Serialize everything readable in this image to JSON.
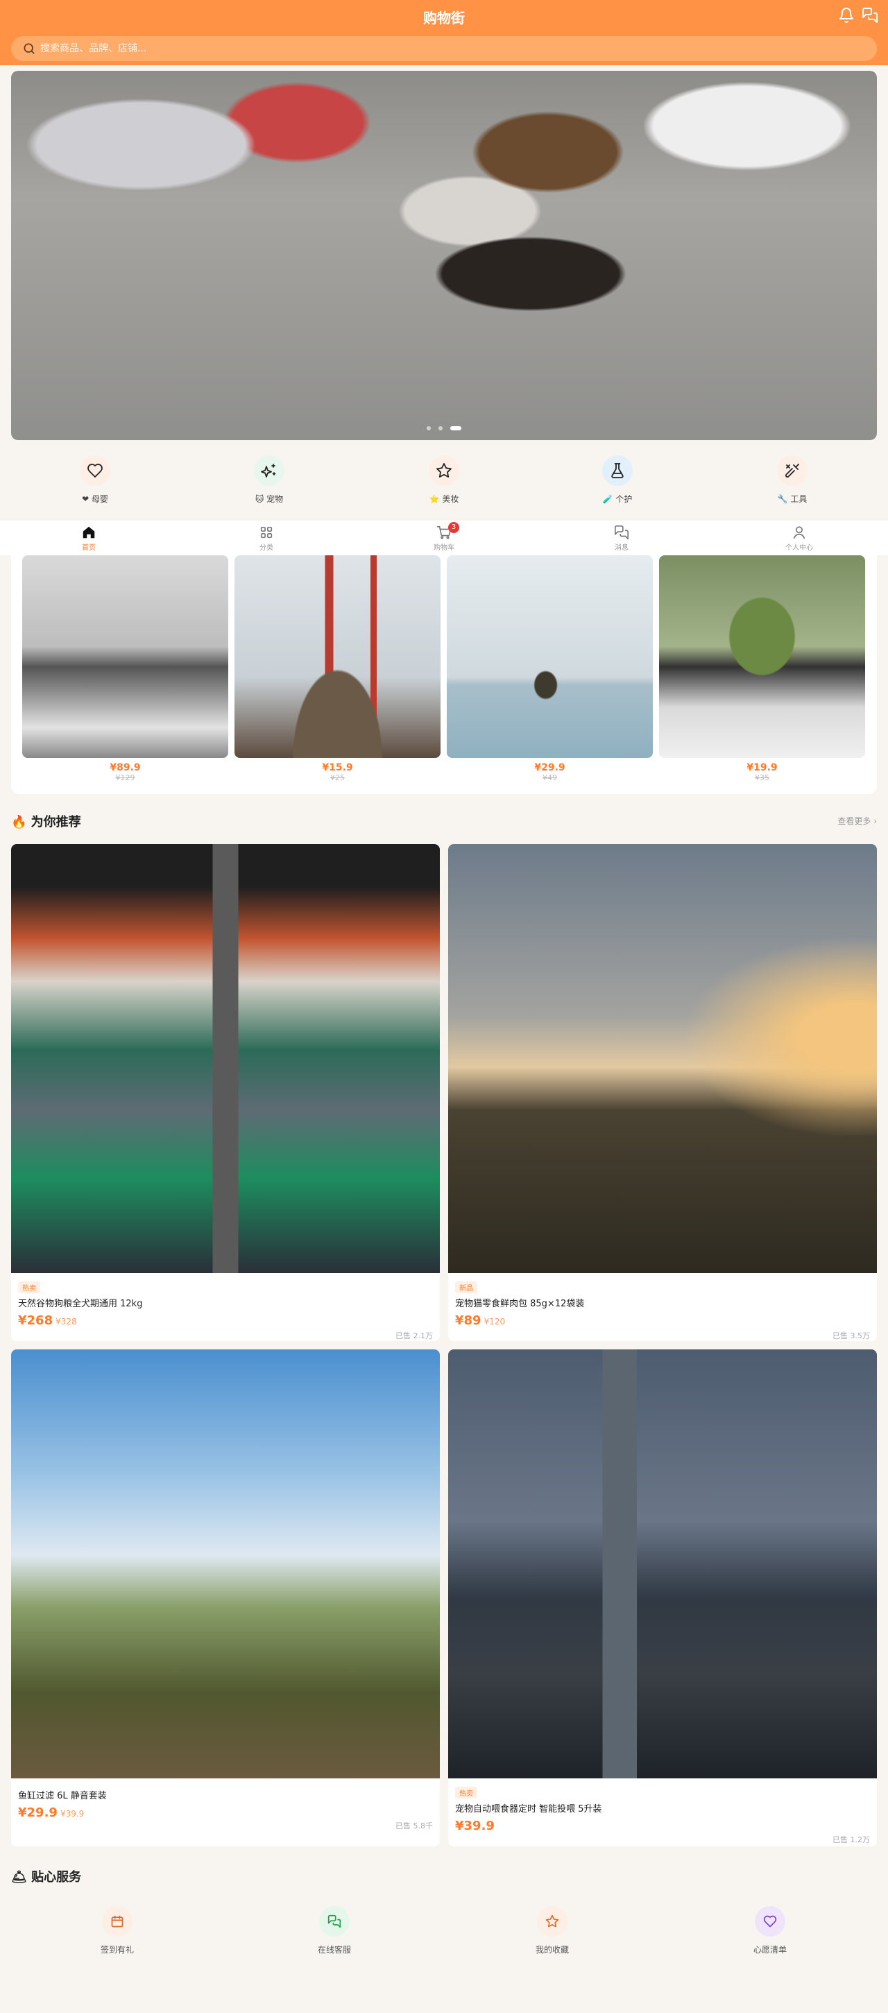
{
  "app": {
    "title": "购物街"
  },
  "search": {
    "placeholder": "搜索商品、品牌、店铺..."
  },
  "banner": {
    "slides": 3,
    "active_slide": 3
  },
  "categories": [
    {
      "label": "❤ 母婴",
      "icon": "heart-icon",
      "bg": "#fdeee6",
      "color": "#222"
    },
    {
      "label": "🐱 宠物",
      "icon": "sparkles-icon",
      "bg": "#e8f7ee",
      "color": "#222"
    },
    {
      "label": "⭐ 美妆",
      "icon": "star-icon",
      "bg": "#fdeee6",
      "color": "#222"
    },
    {
      "label": "🧪 个护",
      "icon": "flask-icon",
      "bg": "#e1f0fb",
      "color": "#222"
    },
    {
      "label": "🔧 工具",
      "icon": "tools-icon",
      "bg": "#fdeee6",
      "color": "#222"
    }
  ],
  "tabbar": {
    "items": [
      {
        "label": "首页",
        "icon": "home-icon",
        "active": true
      },
      {
        "label": "分类",
        "icon": "grid-icon",
        "active": false
      },
      {
        "label": "购物车",
        "icon": "cart-icon",
        "active": false,
        "badge": "3"
      },
      {
        "label": "消息",
        "icon": "chat-icon",
        "active": false
      },
      {
        "label": "个人中心",
        "icon": "user-icon",
        "active": false
      }
    ]
  },
  "flash_sale": {
    "items": [
      {
        "price": "¥89.9",
        "original": "¥129"
      },
      {
        "price": "¥15.9",
        "original": "¥25"
      },
      {
        "price": "¥29.9",
        "original": "¥49"
      },
      {
        "price": "¥19.9",
        "original": "¥35"
      }
    ]
  },
  "recommend": {
    "title": "🔥 为你推荐",
    "more": "查看更多 ›",
    "products": [
      {
        "tag": "热卖",
        "name": "天然谷物狗粮全犬期通用 12kg",
        "price": "¥268",
        "original": "¥328",
        "sold": "已售 2.1万"
      },
      {
        "tag": "新品",
        "name": "宠物猫零食鲜肉包 85g×12袋装",
        "price": "¥89",
        "original": "¥120",
        "sold": "已售 3.5万"
      },
      {
        "tag": "",
        "name": "鱼缸过滤 6L 静音套装",
        "price": "¥29.9",
        "original": "¥39.9",
        "sold": "已售 5.8千"
      },
      {
        "tag": "热卖",
        "name": "宠物自动喂食器定时 智能投喂 5升装",
        "price": "¥39.9",
        "original": "",
        "sold": "已售 1.2万"
      }
    ]
  },
  "services": {
    "title": "🛎 贴心服务",
    "items": [
      {
        "label": "签到有礼",
        "icon": "calendar-icon",
        "bg": "#fdeee6",
        "color": "#e0672a"
      },
      {
        "label": "在线客服",
        "icon": "chat-icon",
        "bg": "#e5f6ea",
        "color": "#2b9a4a"
      },
      {
        "label": "我的收藏",
        "icon": "star-icon",
        "bg": "#fdeee6",
        "color": "#e0672a"
      },
      {
        "label": "心愿清单",
        "icon": "heart-icon",
        "bg": "#efe4fb",
        "color": "#7a3fc7"
      }
    ]
  },
  "colors": {
    "primary": "#ff9244",
    "accent": "#ff7a29",
    "badge": "#e53935"
  }
}
